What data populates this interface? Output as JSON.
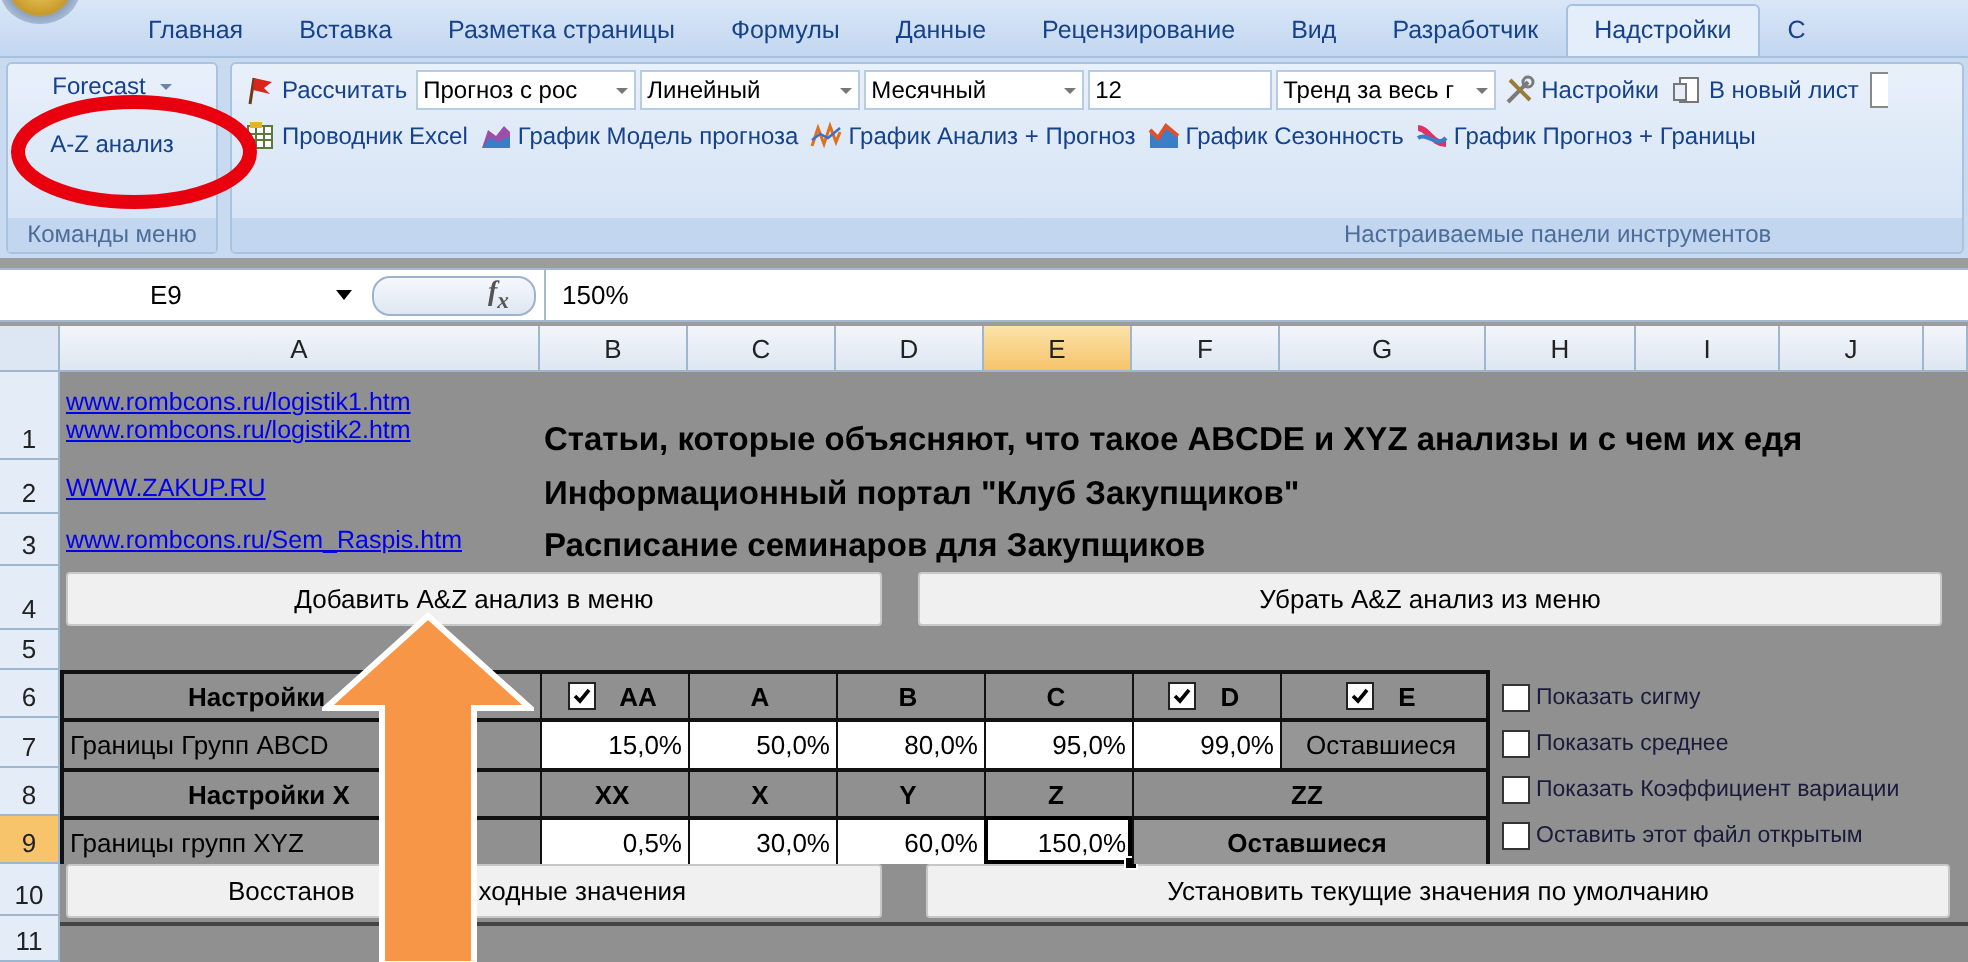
{
  "ribbon_tabs": [
    {
      "label": "Главная",
      "selected": false
    },
    {
      "label": "Вставка",
      "selected": false
    },
    {
      "label": "Разметка страницы",
      "selected": false
    },
    {
      "label": "Формулы",
      "selected": false
    },
    {
      "label": "Данные",
      "selected": false
    },
    {
      "label": "Рецензирование",
      "selected": false
    },
    {
      "label": "Вид",
      "selected": false
    },
    {
      "label": "Разработчик",
      "selected": false
    },
    {
      "label": "Надстройки",
      "selected": true
    },
    {
      "label": "С",
      "selected": false
    }
  ],
  "menu_group": {
    "forecast_button": "Forecast",
    "az_button": "A-Z анализ",
    "label": "Команды меню"
  },
  "toolbar_group": {
    "label": "Настраиваемые панели инструментов",
    "row_1": [
      {
        "kind": "button",
        "label": "Рассчитать"
      },
      {
        "kind": "combo",
        "value": "Прогноз с рос"
      },
      {
        "kind": "combo",
        "value": "Линейный"
      },
      {
        "kind": "combo",
        "value": "Месячный"
      },
      {
        "kind": "field",
        "value": "12"
      },
      {
        "kind": "combo",
        "value": "Тренд за весь г"
      },
      {
        "kind": "button",
        "label": "Настройки"
      },
      {
        "kind": "button",
        "label": "В новый лист"
      }
    ],
    "row_2": [
      {
        "label": "Проводник Excel"
      },
      {
        "label": "График Модель прогноза"
      },
      {
        "label": "График Анализ + Прогноз"
      },
      {
        "label": "График Сезонность"
      },
      {
        "label": "График Прогноз + Границы"
      }
    ]
  },
  "formula_bar": {
    "name_box": "E9",
    "function_label": "f$_{x}$",
    "formula": "150%"
  },
  "columns": [
    {
      "label": "A",
      "selected": false
    },
    {
      "label": "B",
      "selected": false
    },
    {
      "label": "C",
      "selected": false
    },
    {
      "label": "D",
      "selected": false
    },
    {
      "label": "E",
      "selected": true
    },
    {
      "label": "F",
      "selected": false
    },
    {
      "label": "G",
      "selected": false
    },
    {
      "label": "H",
      "selected": false
    },
    {
      "label": "I",
      "selected": false
    },
    {
      "label": "J",
      "selected": false
    }
  ],
  "rows": [
    {
      "label": "1",
      "selected": false
    },
    {
      "label": "2",
      "selected": false
    },
    {
      "label": "3",
      "selected": false
    },
    {
      "label": "4",
      "selected": false
    },
    {
      "label": "5",
      "selected": false
    },
    {
      "label": "6",
      "selected": false
    },
    {
      "label": "7",
      "selected": false
    },
    {
      "label": "8",
      "selected": false
    },
    {
      "label": "9",
      "selected": true
    },
    {
      "label": "10",
      "selected": false
    },
    {
      "label": "11",
      "selected": false
    }
  ],
  "info_rows": [
    {
      "links": [
        "www.rombcons.ru/logistik1.htm",
        "www.rombcons.ru/logistik2.htm"
      ],
      "text": "Статьи, которые объясняют, что такое ABCDE и XYZ анализы и с чем их едя"
    },
    {
      "links": [
        "WWW.ZAKUP.RU"
      ],
      "text": "Информационный портал \"Клуб Закупщиков\""
    },
    {
      "links": [
        "www.rombcons.ru/Sem_Raspis.htm"
      ],
      "text": "Расписание семинаров для Закупщиков"
    }
  ],
  "menu_buttons": [
    {
      "label_parts": [
        "Добавить A&Z анализ в меню"
      ]
    },
    {
      "label_parts": [
        "Убрать A&Z анализ из меню"
      ]
    }
  ],
  "abcde": {
    "header_label": "Настройки",
    "values_label": "Границы Групп ABCD",
    "headers": [
      {
        "label": "AA",
        "kind": "checkbox",
        "checked": true
      },
      {
        "label": "A",
        "kind": "plain"
      },
      {
        "label": "B",
        "kind": "plain"
      },
      {
        "label": "C",
        "kind": "plain"
      },
      {
        "label": "D",
        "kind": "checkbox",
        "checked": true
      },
      {
        "label": "E",
        "kind": "checkbox",
        "checked": true
      }
    ],
    "values": [
      {
        "text": "15,0%",
        "kind": "input",
        "selected": false
      },
      {
        "text": "50,0%",
        "kind": "input",
        "selected": false
      },
      {
        "text": "80,0%",
        "kind": "input",
        "selected": false
      },
      {
        "text": "95,0%",
        "kind": "input",
        "selected": false
      },
      {
        "text": "99,0%",
        "kind": "input",
        "selected": false
      },
      {
        "text": "Оставшиеся",
        "kind": "fixed",
        "selected": false
      }
    ]
  },
  "xyz": {
    "header_label": "Настройки X",
    "values_label": "Границы групп XYZ",
    "headers": [
      {
        "label": "XX",
        "kind": "plain"
      },
      {
        "label": "X",
        "kind": "plain"
      },
      {
        "label": "Y",
        "kind": "plain"
      },
      {
        "label": "Z",
        "kind": "plain"
      },
      {
        "label": "ZZ",
        "kind": "merged"
      }
    ],
    "values": [
      {
        "text": "0,5%",
        "kind": "input",
        "selected": false
      },
      {
        "text": "30,0%",
        "kind": "input",
        "selected": false
      },
      {
        "text": "60,0%",
        "kind": "input",
        "selected": false
      },
      {
        "text": "150,0%",
        "kind": "input",
        "selected": true
      },
      {
        "text": "Оставшиеся",
        "kind": "merged",
        "selected": false
      }
    ]
  },
  "options": [
    {
      "label": "Показать сигму",
      "checked": false
    },
    {
      "label": "Показать среднее",
      "checked": false
    },
    {
      "label": "Показать Коэффициент вариации",
      "checked": false
    },
    {
      "label": "Оставить этот файл открытым",
      "checked": false
    }
  ],
  "bottom_buttons": [
    {
      "label_parts": [
        "Восстанов",
        "ходные значения"
      ]
    },
    {
      "label_parts": [
        "Установить текущие значения по умолчанию"
      ]
    }
  ]
}
